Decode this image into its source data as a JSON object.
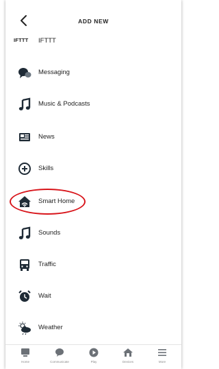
{
  "header": {
    "title": "ADD NEW"
  },
  "items": [
    {
      "logo": "IFTTT",
      "label": "IFTTT",
      "icon": "ifttt-logo"
    },
    {
      "label": "Messaging",
      "icon": "chat-bubbles-icon"
    },
    {
      "label": "Music & Podcasts",
      "icon": "music-note-icon"
    },
    {
      "label": "News",
      "icon": "newspaper-icon"
    },
    {
      "label": "Skills",
      "icon": "skills-plus-icon"
    },
    {
      "label": "Smart Home",
      "icon": "smart-home-icon"
    },
    {
      "label": "Sounds",
      "icon": "music-note-icon"
    },
    {
      "label": "Traffic",
      "icon": "bus-icon"
    },
    {
      "label": "Wait",
      "icon": "alarm-clock-icon"
    },
    {
      "label": "Weather",
      "icon": "weather-icon"
    }
  ],
  "tabs": [
    {
      "label": "Home",
      "icon": "home-icon"
    },
    {
      "label": "Communicate",
      "icon": "chat-icon"
    },
    {
      "label": "Play",
      "icon": "play-icon"
    },
    {
      "label": "Devices",
      "icon": "devices-icon"
    },
    {
      "label": "More",
      "icon": "menu-icon"
    }
  ],
  "colors": {
    "highlight": "#d8141a",
    "icon": "#1f2b36"
  }
}
